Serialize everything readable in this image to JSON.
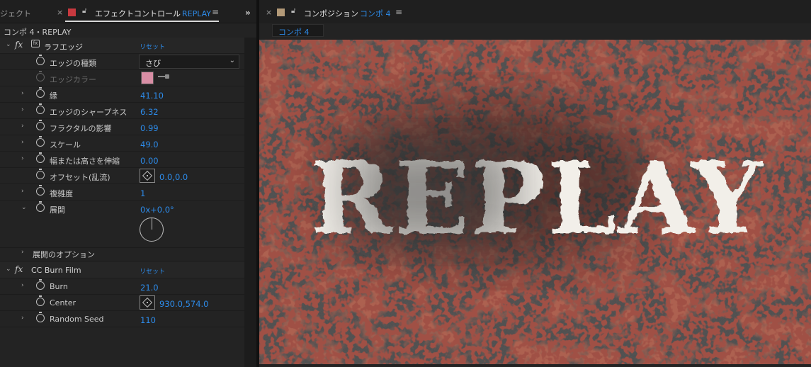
{
  "left_panel": {
    "tabs": {
      "project_partial": "ジェクト",
      "close": "×",
      "effect_controls_title": "エフェクトコントロール",
      "effect_controls_layer": "REPLAY",
      "menu": "≡",
      "overflow": "»"
    },
    "breadcrumb": "コンポ 4・REPLAY",
    "effects": [
      {
        "fx": "fx",
        "name": "ラフエッジ",
        "reset": "リセット",
        "params": [
          {
            "name": "エッジの種類",
            "value": "さび"
          },
          {
            "name": "エッジカラー",
            "value": ""
          },
          {
            "name": "縁",
            "value": "41.10"
          },
          {
            "name": "エッジのシャープネス",
            "value": "6.32"
          },
          {
            "name": "フラクタルの影響",
            "value": "0.99"
          },
          {
            "name": "スケール",
            "value": "49.0"
          },
          {
            "name": "幅または高さを伸縮",
            "value": "0.00"
          },
          {
            "name": "オフセット(乱流)",
            "value": "0.0,0.0"
          },
          {
            "name": "複雑度",
            "value": "1"
          },
          {
            "name": "展開",
            "value": "0x+0.0°"
          },
          {
            "name": "展開のオプション",
            "value": ""
          }
        ]
      },
      {
        "fx": "fx",
        "name": "CC Burn Film",
        "reset": "リセット",
        "params": [
          {
            "name": "Burn",
            "value": "21.0"
          },
          {
            "name": "Center",
            "value": "930.0,574.0"
          },
          {
            "name": "Random Seed",
            "value": "110"
          }
        ]
      }
    ],
    "edge_color": "#d98ea5"
  },
  "right_panel": {
    "tabs": {
      "close": "×",
      "composition_title": "コンポジション",
      "composition_name": "コンポ 4",
      "menu": "≡"
    },
    "subtab": "コンポ 4",
    "viewer_text": "REPLAY"
  },
  "colors": {
    "accent_blue": "#2d8ceb",
    "ec_tab_chip": "#c8393f",
    "comp_tab_chip": "#b39a78",
    "panel_bg": "#232323"
  }
}
